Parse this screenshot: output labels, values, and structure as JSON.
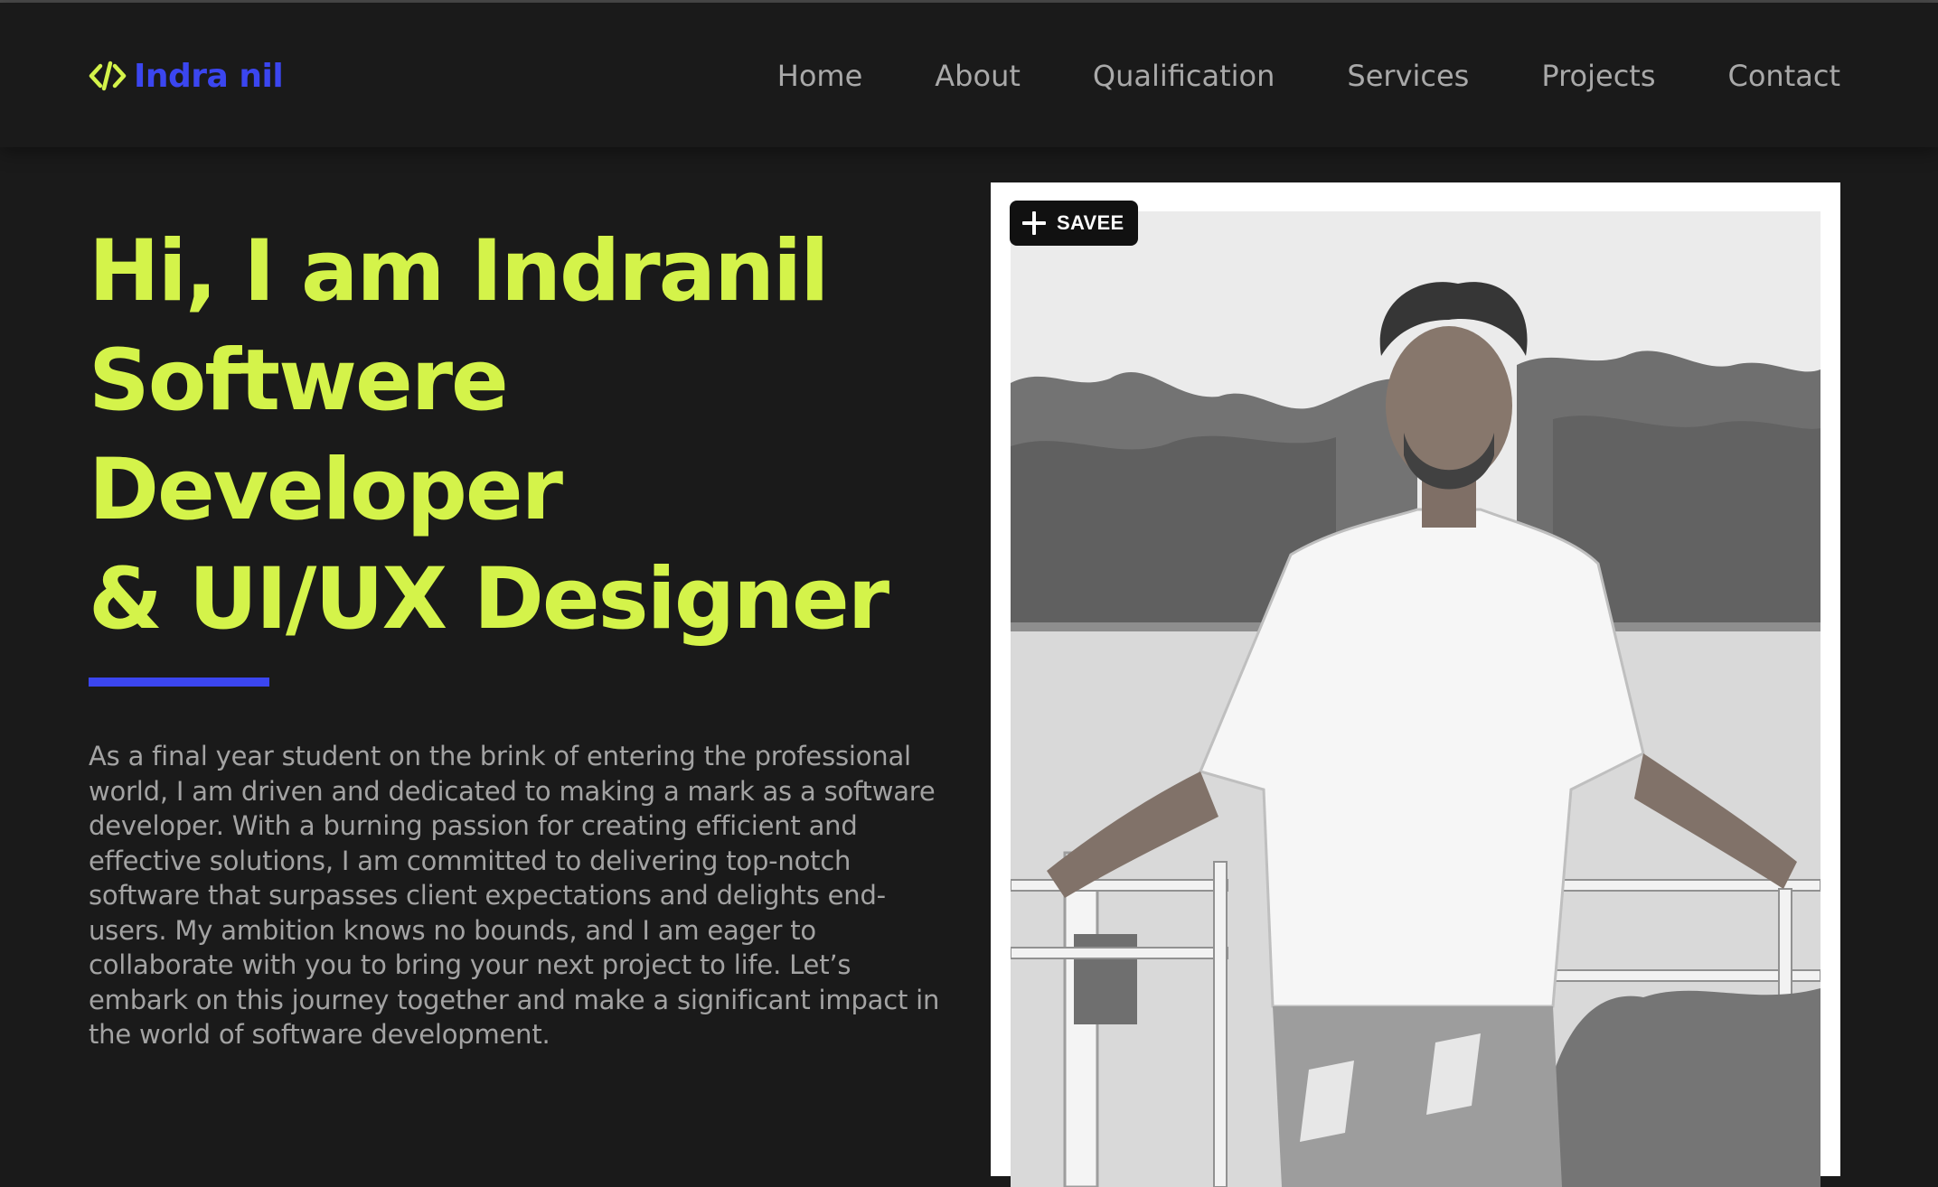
{
  "colors": {
    "accent_lime": "#d4f34a",
    "accent_blue": "#3b46f0",
    "background": "#1a1a1a",
    "body_text": "#a3a3a3"
  },
  "header": {
    "logo_icon": "code-brackets-icon",
    "logo_text": "Indra nil",
    "nav": [
      "Home",
      "About",
      "Qualification",
      "Services",
      "Projects",
      "Contact"
    ]
  },
  "hero": {
    "title_lines": [
      "Hi, I am Indranil",
      "Softwere",
      "Developer",
      "& UI/UX Designer"
    ],
    "bio": "As a final year student on the brink of entering the professional world, I am driven and dedicated to making a mark as a software developer. With a burning passion for creating efficient and effective solutions, I am committed to delivering top-notch software that surpasses client expectations and delights end-users. My ambition knows no bounds, and I am eager to collaborate with you to bring your next project to life. Let’s embark on this journey together and make a significant impact in the world of software development."
  },
  "photo": {
    "save_icon": "plus-icon",
    "save_label": "SAVEE"
  }
}
